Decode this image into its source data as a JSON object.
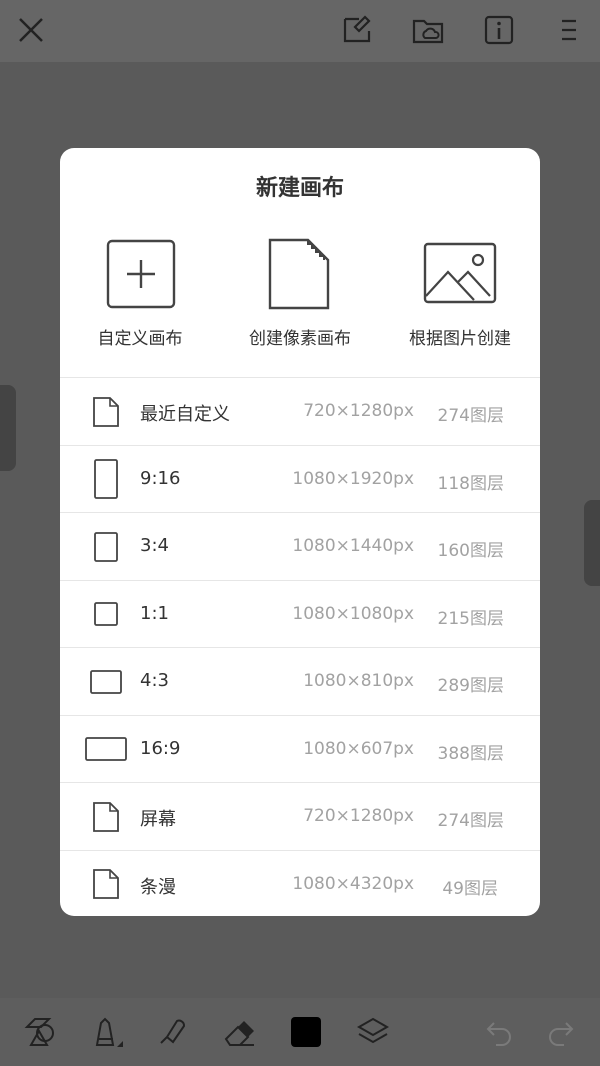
{
  "dialog": {
    "title": "新建画布",
    "create_options": [
      {
        "label": "自定义画布",
        "icon": "plus-square-icon"
      },
      {
        "label": "创建像素画布",
        "icon": "pixel-document-icon"
      },
      {
        "label": "根据图片创建",
        "icon": "image-icon"
      }
    ],
    "presets": [
      {
        "name": "最近自定义",
        "size": "720×1280px",
        "layers": "274图层",
        "icon": "document-icon"
      },
      {
        "name": "9:16",
        "size": "1080×1920px",
        "layers": "118图层",
        "icon": "ratio-9-16-icon"
      },
      {
        "name": "3:4",
        "size": "1080×1440px",
        "layers": "160图层",
        "icon": "ratio-3-4-icon"
      },
      {
        "name": "1:1",
        "size": "1080×1080px",
        "layers": "215图层",
        "icon": "ratio-1-1-icon"
      },
      {
        "name": "4:3",
        "size": "1080×810px",
        "layers": "289图层",
        "icon": "ratio-4-3-icon"
      },
      {
        "name": "16:9",
        "size": "1080×607px",
        "layers": "388图层",
        "icon": "ratio-16-9-icon"
      },
      {
        "name": "屏幕",
        "size": "720×1280px",
        "layers": "274图层",
        "icon": "document-icon"
      },
      {
        "name": "条漫",
        "size": "1080×4320px",
        "layers": "49图层",
        "icon": "document-icon"
      }
    ]
  },
  "topbar": {
    "icons": [
      "close-icon",
      "canvas-edit-icon",
      "cloud-folder-icon",
      "info-icon",
      "menu-icon"
    ]
  },
  "bottombar": {
    "icons": [
      "shapes-icon",
      "pencil-icon",
      "smudge-icon",
      "eraser-icon",
      "color-swatch-icon",
      "layers-icon",
      "undo-icon",
      "redo-icon"
    ],
    "current_color": "#000000"
  },
  "colors": {
    "backdrop": "#5a5a5a",
    "dialog_bg": "#ffffff",
    "secondary_text": "#a2a2a2"
  }
}
